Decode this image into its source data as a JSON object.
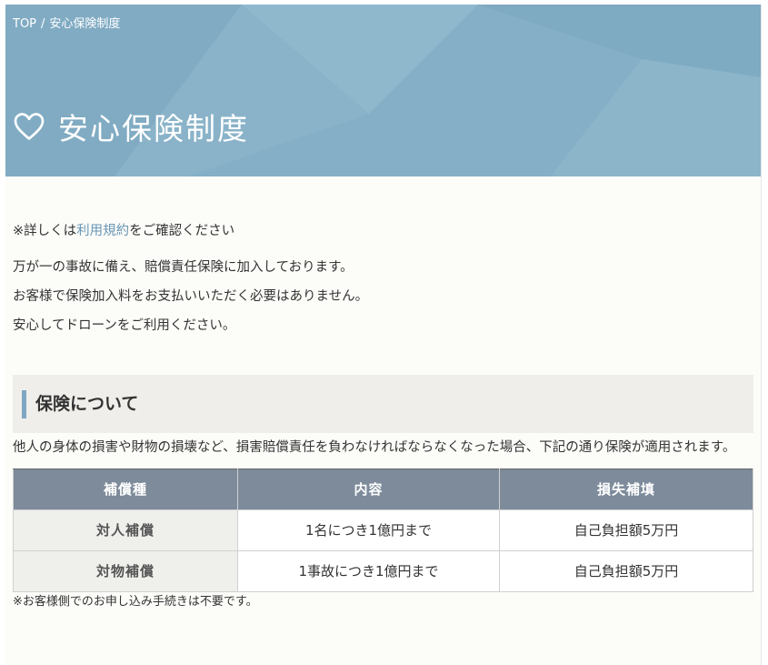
{
  "breadcrumb": {
    "home": "TOP",
    "separator": "/",
    "current": "安心保険制度"
  },
  "hero": {
    "title": "安心保険制度",
    "icon": "heart-outline-icon",
    "bg_color": "#87b1c8"
  },
  "intro": {
    "note_prefix": "※詳しくは",
    "note_link": "利用規約",
    "note_suffix": "をご確認ください",
    "lines": [
      "万が一の事故に備え、賠償責任保険に加入しております。",
      "お客様で保険加入料をお支払いいただく必要はありません。",
      "安心してドローンをご利用ください。"
    ]
  },
  "section": {
    "title": "保険について",
    "accent_color": "#7fa6c3",
    "lead": "他人の身体の損害や財物の損壊など、損害賠償責任を負わなければならなくなった場合、下記の通り保険が適用されます。"
  },
  "table": {
    "headers": [
      "補償種",
      "内容",
      "損失補填"
    ],
    "rows": [
      [
        "対人補償",
        "1名につき1億円まで",
        "自己負担額5万円"
      ],
      [
        "対物補償",
        "1事故につき1億円まで",
        "自己負担額5万円"
      ]
    ],
    "header_color": "#7d8b9b"
  },
  "footnote": "※お客様側でのお申し込み手続きは不要です。"
}
